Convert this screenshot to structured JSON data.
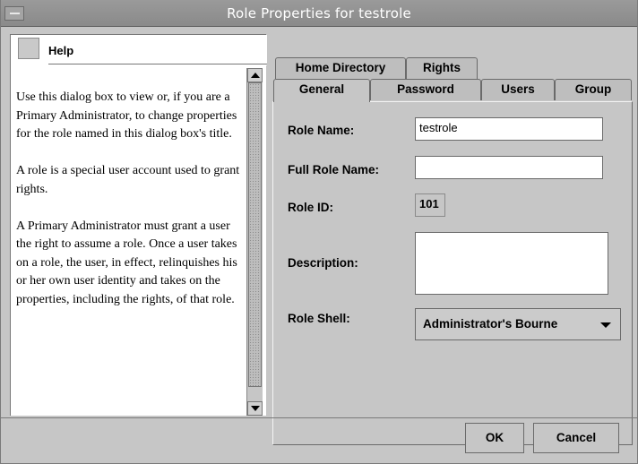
{
  "window": {
    "title": "Role Properties for testrole"
  },
  "help": {
    "title": "Help",
    "paragraphs": [
      "Use this dialog box to view or, if you are a Primary Administrator, to change properties for the role named in this dialog box's title.",
      "A role is a special user account used to grant rights.",
      "A Primary Administrator must grant a user the right to assume a role. Once a user takes on a role, the user, in effect, relinquishes his or her own user identity and takes on the properties, including the rights, of that role."
    ]
  },
  "tabs": {
    "row1": [
      {
        "label": "Home Directory",
        "mnemonic": ""
      },
      {
        "label": "Rights",
        "mnemonic": ""
      }
    ],
    "row2": [
      {
        "label": "General",
        "active": true
      },
      {
        "label": "Password"
      },
      {
        "label": "Users"
      },
      {
        "label": "Group"
      }
    ]
  },
  "form": {
    "role_name": {
      "label": "Role Name:",
      "value": "testrole"
    },
    "full_role_name": {
      "label": "Full Role Name:",
      "value": ""
    },
    "role_id": {
      "label": "Role ID:",
      "value": "101"
    },
    "description": {
      "label": "Description:",
      "value": ""
    },
    "role_shell": {
      "label": "Role Shell:",
      "value": "Administrator's Bourne"
    }
  },
  "buttons": {
    "ok": "OK",
    "cancel": "Cancel"
  }
}
